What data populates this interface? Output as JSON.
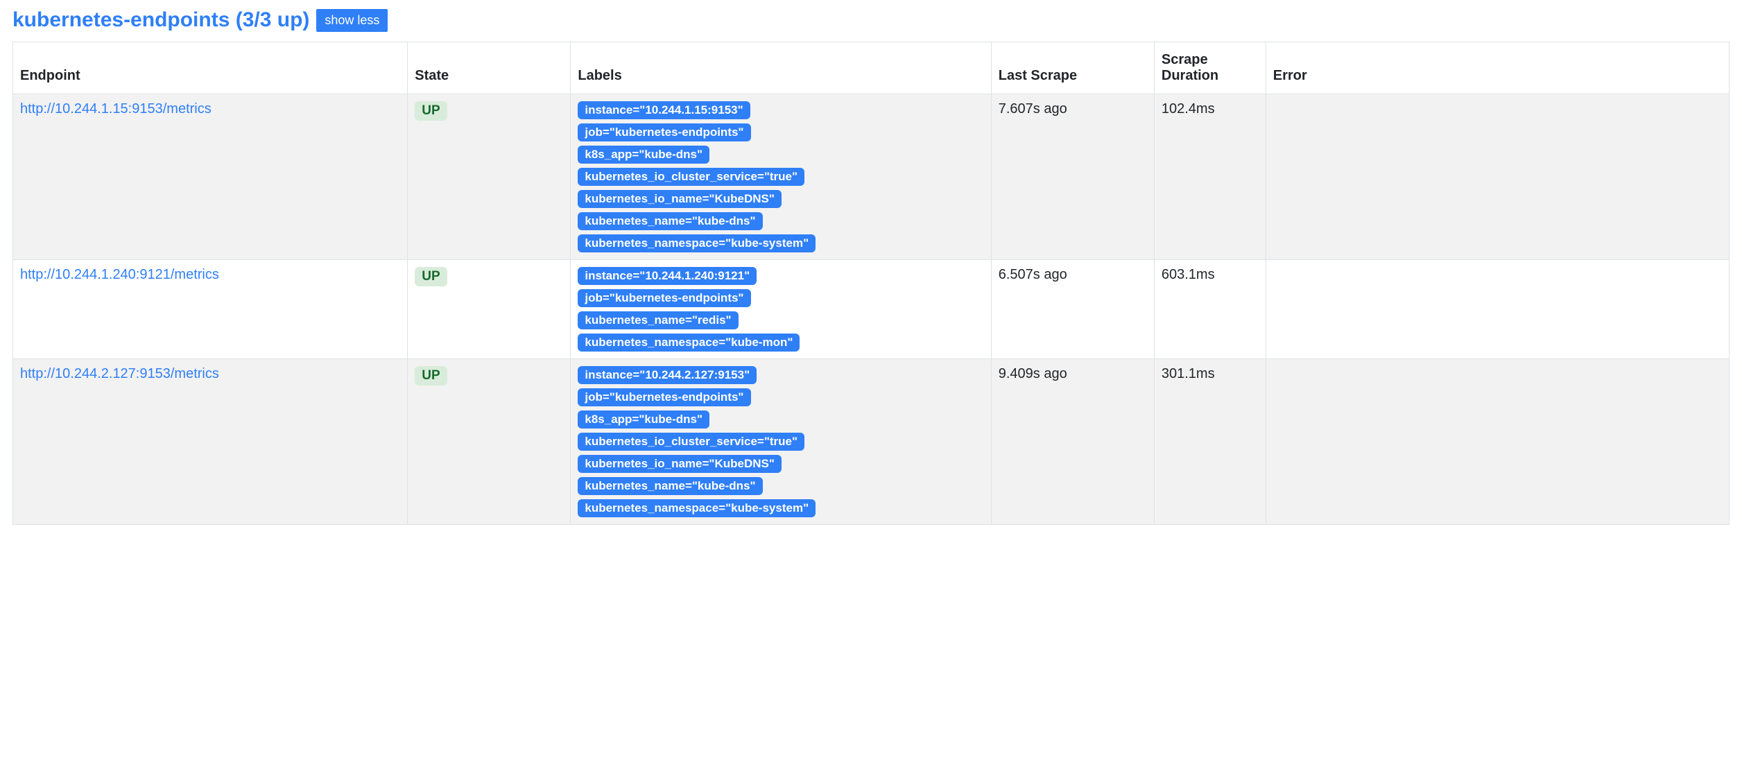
{
  "header": {
    "title": "kubernetes-endpoints (3/3 up)",
    "toggle_label": "show less"
  },
  "columns": {
    "endpoint": "Endpoint",
    "state": "State",
    "labels": "Labels",
    "last_scrape": "Last Scrape",
    "scrape_duration": "Scrape Duration",
    "error": "Error"
  },
  "rows": [
    {
      "endpoint": "http://10.244.1.15:9153/metrics",
      "state": "UP",
      "labels": [
        "instance=\"10.244.1.15:9153\"",
        "job=\"kubernetes-endpoints\"",
        "k8s_app=\"kube-dns\"",
        "kubernetes_io_cluster_service=\"true\"",
        "kubernetes_io_name=\"KubeDNS\"",
        "kubernetes_name=\"kube-dns\"",
        "kubernetes_namespace=\"kube-system\""
      ],
      "last_scrape": "7.607s ago",
      "scrape_duration": "102.4ms",
      "error": ""
    },
    {
      "endpoint": "http://10.244.1.240:9121/metrics",
      "state": "UP",
      "labels": [
        "instance=\"10.244.1.240:9121\"",
        "job=\"kubernetes-endpoints\"",
        "kubernetes_name=\"redis\"",
        "kubernetes_namespace=\"kube-mon\""
      ],
      "last_scrape": "6.507s ago",
      "scrape_duration": "603.1ms",
      "error": ""
    },
    {
      "endpoint": "http://10.244.2.127:9153/metrics",
      "state": "UP",
      "labels": [
        "instance=\"10.244.2.127:9153\"",
        "job=\"kubernetes-endpoints\"",
        "k8s_app=\"kube-dns\"",
        "kubernetes_io_cluster_service=\"true\"",
        "kubernetes_io_name=\"KubeDNS\"",
        "kubernetes_name=\"kube-dns\"",
        "kubernetes_namespace=\"kube-system\""
      ],
      "last_scrape": "9.409s ago",
      "scrape_duration": "301.1ms",
      "error": ""
    }
  ]
}
